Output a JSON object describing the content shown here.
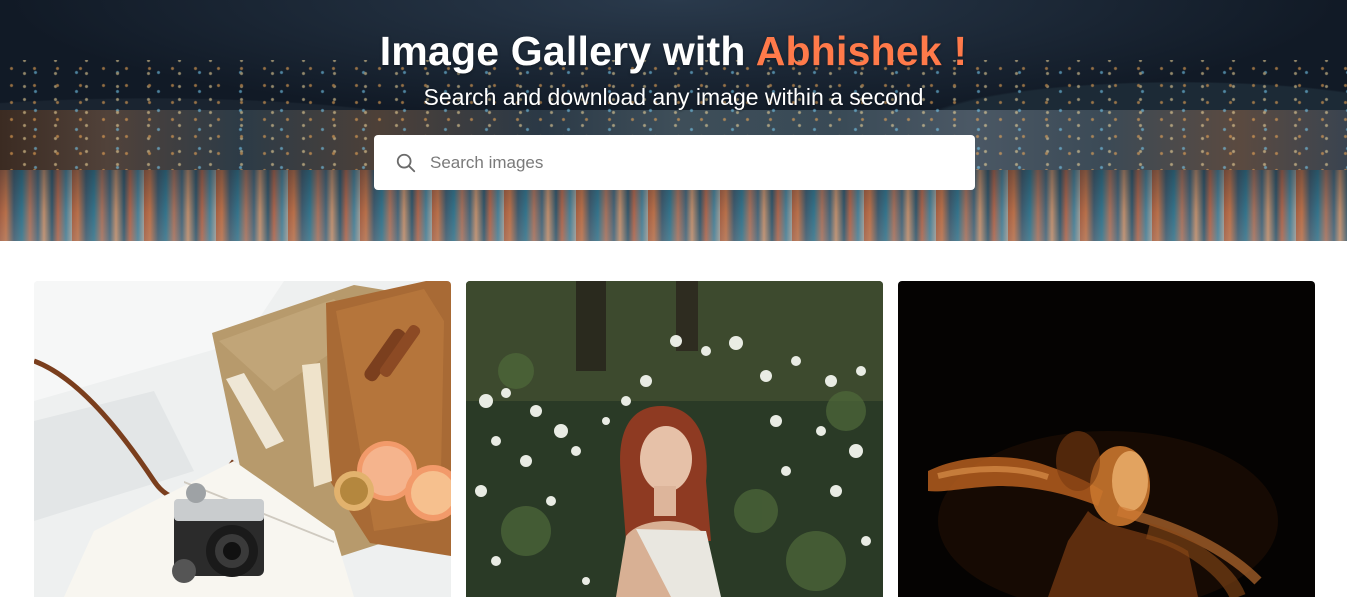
{
  "header": {
    "title_main": "Image Gallery with ",
    "title_accent": "Abhishek !",
    "subtitle": "Search and download any image within a second",
    "accent_color": "#ff7a4a"
  },
  "search": {
    "placeholder": "Search images",
    "value": "",
    "icon": "search-icon"
  },
  "gallery": {
    "images": [
      {
        "subject": "flat-lay with camera, open book, burlap and grapefruit slices"
      },
      {
        "subject": "red-haired woman in front of white flowering shrub"
      },
      {
        "subject": "motion-blurred dancer lit in orange on black background"
      }
    ]
  }
}
